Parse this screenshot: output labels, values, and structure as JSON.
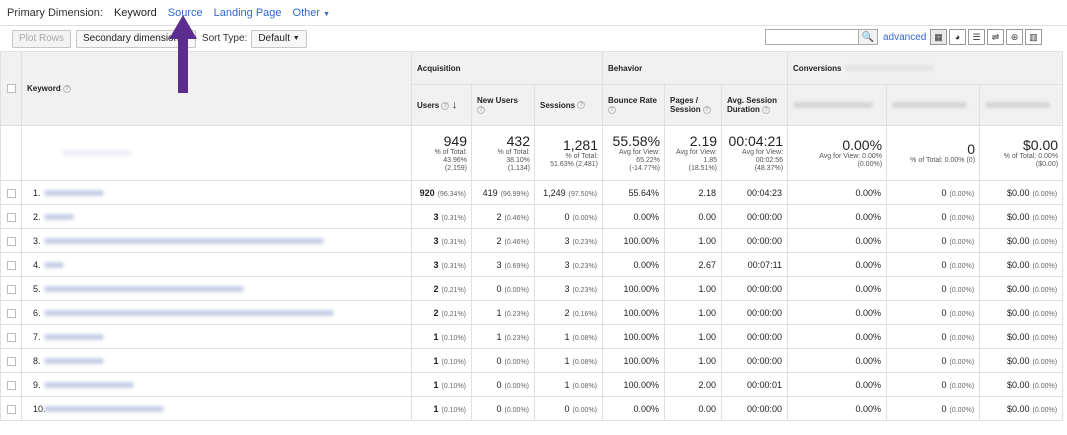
{
  "dimension_bar": {
    "label": "Primary Dimension:",
    "current": "Keyword",
    "options": [
      "Source",
      "Landing Page",
      "Other"
    ]
  },
  "toolbar": {
    "plot_rows": "Plot Rows",
    "secondary_dimension": "Secondary dimension",
    "sort_type_label": "Sort Type:",
    "sort_value": "Default",
    "advanced": "advanced"
  },
  "groups": {
    "acquisition": "Acquisition",
    "behavior": "Behavior",
    "conversions": "Conversions"
  },
  "columns": {
    "keyword": "Keyword",
    "users": "Users",
    "new_users": "New Users",
    "sessions": "Sessions",
    "bounce_rate": "Bounce Rate",
    "pages_session_1": "Pages /",
    "pages_session_2": "Session",
    "avg_duration_1": "Avg. Session",
    "avg_duration_2": "Duration"
  },
  "totals": {
    "users": {
      "v": "949",
      "s1": "% of Total:",
      "s2": "43.96%",
      "s3": "(2,159)"
    },
    "new_users": {
      "v": "432",
      "s1": "% of Total:",
      "s2": "38.10%",
      "s3": "(1,134)"
    },
    "sessions": {
      "v": "1,281",
      "s1": "% of Total:",
      "s2": "51.63% (2,481)",
      "s3": ""
    },
    "bounce_rate": {
      "v": "55.58%",
      "s1": "Avg for View:",
      "s2": "65.22%",
      "s3": "(-14.77%)"
    },
    "pages_session": {
      "v": "2.19",
      "s1": "Avg for View:",
      "s2": "1.85",
      "s3": "(18.51%)"
    },
    "avg_duration": {
      "v": "00:04:21",
      "s1": "Avg for View:",
      "s2": "00:02:56",
      "s3": "(48.37%)"
    },
    "conv1": {
      "v": "0.00%",
      "s1": "Avg for View: 0.00%",
      "s2": "(0.00%)",
      "s3": ""
    },
    "conv2": {
      "v": "0",
      "s1": "% of Total: 0.00% (0)",
      "s2": "",
      "s3": ""
    },
    "conv3": {
      "v": "$0.00",
      "s1": "% of Total: 0.00%",
      "s2": "($0.00)",
      "s3": ""
    }
  },
  "rows": [
    {
      "n": "1.",
      "u": "920",
      "up": "(96.34%)",
      "nu": "419",
      "nup": "(96.99%)",
      "s": "1,249",
      "sp": "(97.50%)",
      "br": "55.64%",
      "ps": "2.18",
      "d": "00:04:23",
      "c1": "0.00%",
      "c2": "0",
      "c2p": "(0.00%)",
      "c3": "$0.00",
      "c3p": "(0.00%)"
    },
    {
      "n": "2.",
      "u": "3",
      "up": "(0.31%)",
      "nu": "2",
      "nup": "(0.46%)",
      "s": "0",
      "sp": "(0.00%)",
      "br": "0.00%",
      "ps": "0.00",
      "d": "00:00:00",
      "c1": "0.00%",
      "c2": "0",
      "c2p": "(0.00%)",
      "c3": "$0.00",
      "c3p": "(0.00%)"
    },
    {
      "n": "3.",
      "u": "3",
      "up": "(0.31%)",
      "nu": "2",
      "nup": "(0.46%)",
      "s": "3",
      "sp": "(0.23%)",
      "br": "100.00%",
      "ps": "1.00",
      "d": "00:00:00",
      "c1": "0.00%",
      "c2": "0",
      "c2p": "(0.00%)",
      "c3": "$0.00",
      "c3p": "(0.00%)"
    },
    {
      "n": "4.",
      "u": "3",
      "up": "(0.31%)",
      "nu": "3",
      "nup": "(0.69%)",
      "s": "3",
      "sp": "(0.23%)",
      "br": "0.00%",
      "ps": "2.67",
      "d": "00:07:11",
      "c1": "0.00%",
      "c2": "0",
      "c2p": "(0.00%)",
      "c3": "$0.00",
      "c3p": "(0.00%)"
    },
    {
      "n": "5.",
      "u": "2",
      "up": "(0.21%)",
      "nu": "0",
      "nup": "(0.00%)",
      "s": "3",
      "sp": "(0.23%)",
      "br": "100.00%",
      "ps": "1.00",
      "d": "00:00:00",
      "c1": "0.00%",
      "c2": "0",
      "c2p": "(0.00%)",
      "c3": "$0.00",
      "c3p": "(0.00%)"
    },
    {
      "n": "6.",
      "u": "2",
      "up": "(0.21%)",
      "nu": "1",
      "nup": "(0.23%)",
      "s": "2",
      "sp": "(0.16%)",
      "br": "100.00%",
      "ps": "1.00",
      "d": "00:00:00",
      "c1": "0.00%",
      "c2": "0",
      "c2p": "(0.00%)",
      "c3": "$0.00",
      "c3p": "(0.00%)"
    },
    {
      "n": "7.",
      "u": "1",
      "up": "(0.10%)",
      "nu": "1",
      "nup": "(0.23%)",
      "s": "1",
      "sp": "(0.08%)",
      "br": "100.00%",
      "ps": "1.00",
      "d": "00:00:00",
      "c1": "0.00%",
      "c2": "0",
      "c2p": "(0.00%)",
      "c3": "$0.00",
      "c3p": "(0.00%)"
    },
    {
      "n": "8.",
      "u": "1",
      "up": "(0.10%)",
      "nu": "0",
      "nup": "(0.00%)",
      "s": "1",
      "sp": "(0.08%)",
      "br": "100.00%",
      "ps": "1.00",
      "d": "00:00:00",
      "c1": "0.00%",
      "c2": "0",
      "c2p": "(0.00%)",
      "c3": "$0.00",
      "c3p": "(0.00%)"
    },
    {
      "n": "9.",
      "u": "1",
      "up": "(0.10%)",
      "nu": "0",
      "nup": "(0.00%)",
      "s": "1",
      "sp": "(0.08%)",
      "br": "100.00%",
      "ps": "2.00",
      "d": "00:00:01",
      "c1": "0.00%",
      "c2": "0",
      "c2p": "(0.00%)",
      "c3": "$0.00",
      "c3p": "(0.00%)"
    },
    {
      "n": "10.",
      "u": "1",
      "up": "(0.10%)",
      "nu": "0",
      "nup": "(0.00%)",
      "s": "0",
      "sp": "(0.00%)",
      "br": "0.00%",
      "ps": "0.00",
      "d": "00:00:00",
      "c1": "0.00%",
      "c2": "0",
      "c2p": "(0.00%)",
      "c3": "$0.00",
      "c3p": "(0.00%)"
    }
  ],
  "colors": {
    "link": "#3367d6",
    "arrow": "#5b2d8e",
    "header_bg": "#f1f1f1"
  }
}
